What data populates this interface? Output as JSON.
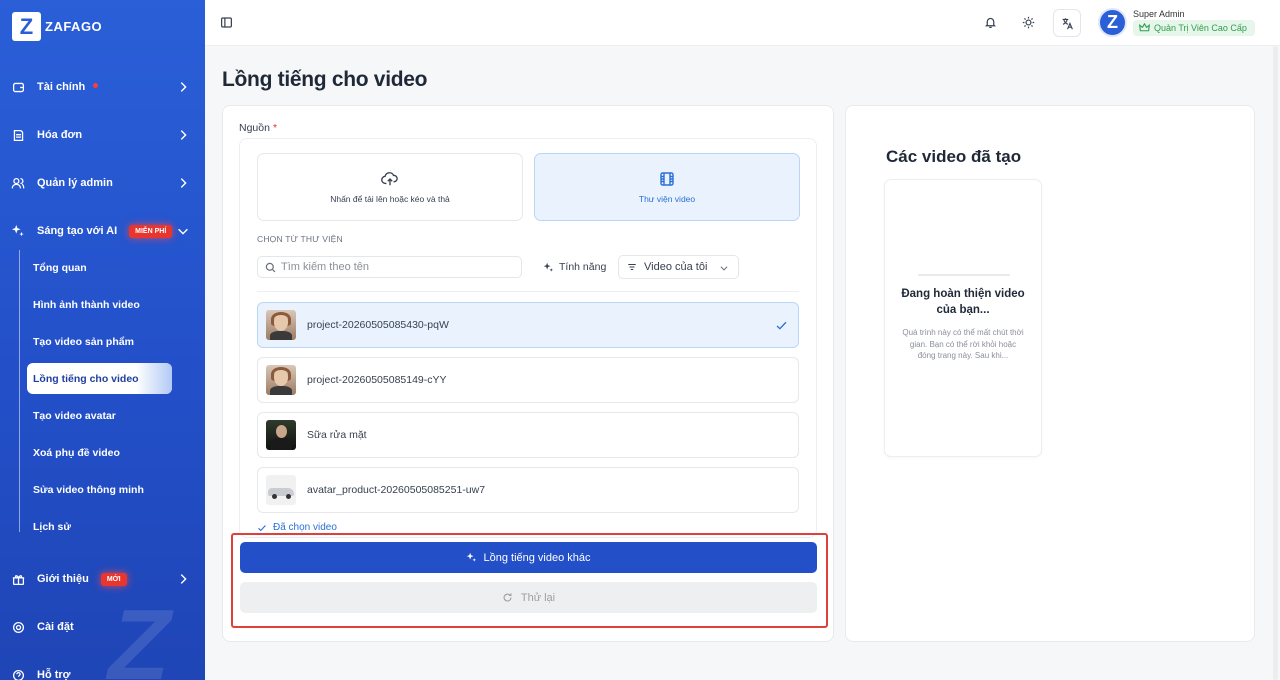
{
  "brand": {
    "logo_letter": "Z",
    "name": "ZAFAGO"
  },
  "sidebar": {
    "items": [
      {
        "label": "Tài chính",
        "icon": "wallet-icon"
      },
      {
        "label": "Hóa đơn",
        "icon": "invoice-icon"
      },
      {
        "label": "Quản lý admin",
        "icon": "users-icon"
      },
      {
        "label": "Sáng tạo với AI",
        "icon": "sparkles-icon",
        "badge": "MIỄN PHÍ"
      },
      {
        "label": "Giới thiệu",
        "icon": "gift-icon",
        "badge": "MỚI"
      },
      {
        "label": "Cài đặt",
        "icon": "gear-icon"
      },
      {
        "label": "Hỗ trợ",
        "icon": "support-icon"
      }
    ],
    "subitems": [
      {
        "label": "Tổng quan"
      },
      {
        "label": "Hình ảnh thành video"
      },
      {
        "label": "Tạo video sản phẩm"
      },
      {
        "label": "Lồng tiếng cho video",
        "active": true
      },
      {
        "label": "Tạo video avatar"
      },
      {
        "label": "Xoá phụ đề video"
      },
      {
        "label": "Sửa video thông minh"
      },
      {
        "label": "Lịch sử"
      }
    ]
  },
  "topbar": {
    "user_name": "Super Admin",
    "user_role": "Quản Trị Viên Cao Cấp",
    "avatar_letter": "Z"
  },
  "page": {
    "title": "Lồng tiếng cho video"
  },
  "form": {
    "source_label": "Nguồn",
    "required_mark": "*",
    "upload_option": "Nhấn để tải lên hoặc kéo và thả",
    "library_option": "Thư viện video",
    "section_label": "CHỌN TỪ THƯ VIỆN",
    "search_placeholder": "Tìm kiếm theo tên",
    "feature_button": "Tính năng",
    "filter_value": "Video của tôi",
    "videos": [
      {
        "name": "project-20260505085430-pqW",
        "selected": true
      },
      {
        "name": "project-20260505085149-cYY",
        "selected": false
      },
      {
        "name": "Sữa rửa mặt",
        "selected": false
      },
      {
        "name": "avatar_product-20260505085251-uw7",
        "selected": false
      }
    ],
    "selected_note": "Đã chọn video",
    "primary_button": "Lồng tiếng video khác",
    "retry_button": "Thử lại"
  },
  "generated": {
    "title": "Các video đã tạo",
    "card_title": "Đang hoàn thiện video của bạn...",
    "card_desc": "Quá trình này có thể mất chút thời gian. Bạn có thể rời khỏi hoặc đóng trang này. Sau khi..."
  },
  "colors": {
    "sidebar": "#2a5fd8",
    "primary_button": "#2350c9",
    "selected_bg": "#eaf3fd",
    "highlight_border": "#e0403a",
    "role_badge": "#2f9e4c"
  }
}
